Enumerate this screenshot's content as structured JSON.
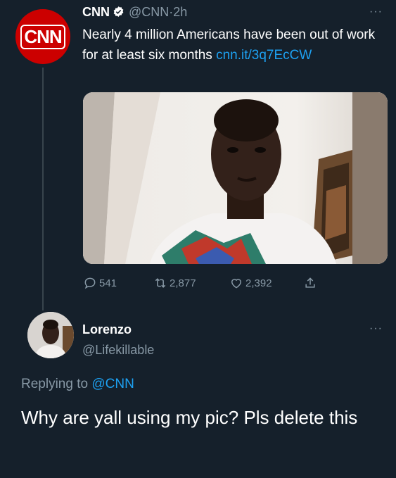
{
  "tweet": {
    "avatar_text": "CNN",
    "name": "CNN",
    "handle": "@CNN",
    "separator": "·",
    "time": "2h",
    "more": "···",
    "text": "Nearly 4 million Americans have been out of work for at least six months ",
    "link": "cnn.it/3q7EcCW",
    "actions": {
      "replies": "541",
      "retweets": "2,877",
      "likes": "2,392"
    }
  },
  "reply": {
    "name": "Lorenzo",
    "handle": "@Lifekillable",
    "more": "···",
    "replying_prefix": "Replying to",
    "replying_mention": "@CNN",
    "text": "Why are yall using my pic? Pls delete this"
  },
  "colors": {
    "background": "#15202b",
    "accent": "#1da1f2",
    "secondary_text": "#8899a6",
    "cnn_red": "#cc0000"
  },
  "icons": [
    "verified-icon",
    "reply-icon",
    "retweet-icon",
    "like-icon",
    "share-icon",
    "more-icon"
  ]
}
